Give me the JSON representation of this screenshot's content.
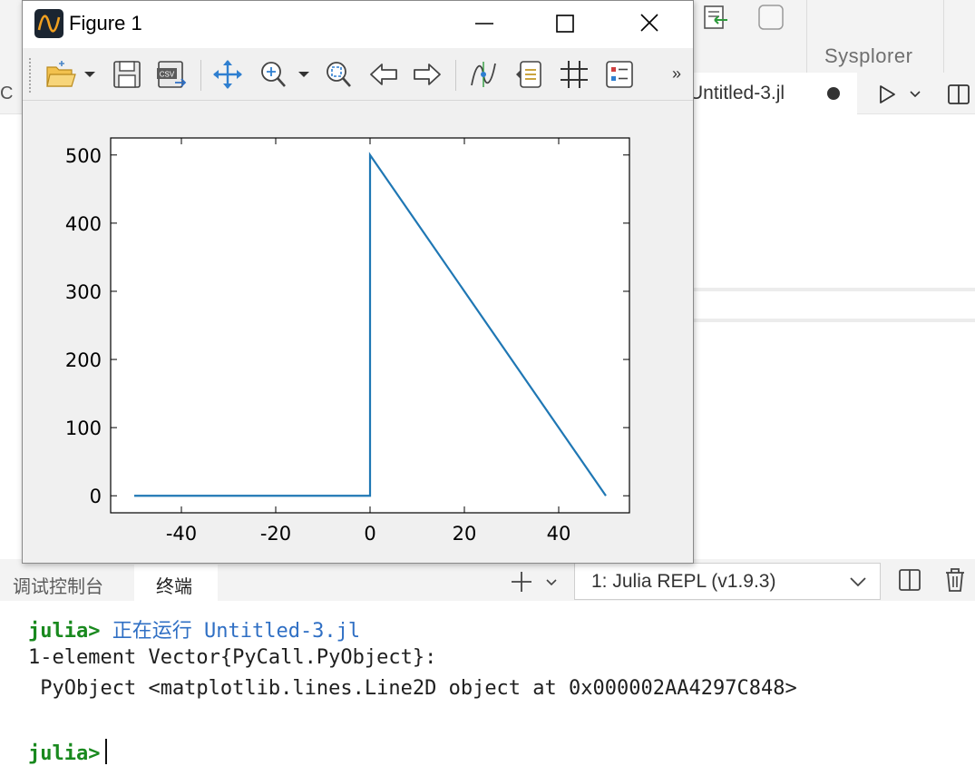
{
  "background": {
    "right_panel_label": "Sysplorer",
    "editor_tab": "Untitled-3.jl",
    "left_strip_char": "C"
  },
  "panel": {
    "tabs": [
      "调试控制台",
      "终端"
    ],
    "terminal_select": "1: Julia REPL (v1.9.3)"
  },
  "terminal": {
    "prompt": "julia>",
    "line1_text": "正在运行 Untitled-3.jl",
    "line2": "1-element Vector{PyCall.PyObject}:",
    "line3": " PyObject <matplotlib.lines.Line2D object at 0x000002AA4297C848>",
    "prompt2": "julia>"
  },
  "figure": {
    "title": "Figure 1",
    "toolbar_icons": [
      "open-folder-icon",
      "save-icon",
      "save-csv-icon",
      "pan-icon",
      "zoom-icon",
      "zoom-fit-icon",
      "back-arrow-icon",
      "forward-arrow-icon",
      "curve-edit-icon",
      "subplots-icon",
      "grid-icon",
      "legend-icon"
    ],
    "toolbar_overflow": "»",
    "csv_text": "CSV"
  },
  "chart_data": {
    "type": "line",
    "title": "",
    "xlabel": "",
    "ylabel": "",
    "xlim": [
      -55,
      55
    ],
    "ylim": [
      -25,
      525
    ],
    "xticks": [
      -40,
      -20,
      0,
      20,
      40
    ],
    "yticks": [
      0,
      100,
      200,
      300,
      400,
      500
    ],
    "grid": false,
    "line_color": "#1f77b4",
    "series": [
      {
        "x": [
          -50,
          0,
          0.0001,
          50
        ],
        "y": [
          0,
          0,
          500,
          0
        ]
      }
    ]
  }
}
